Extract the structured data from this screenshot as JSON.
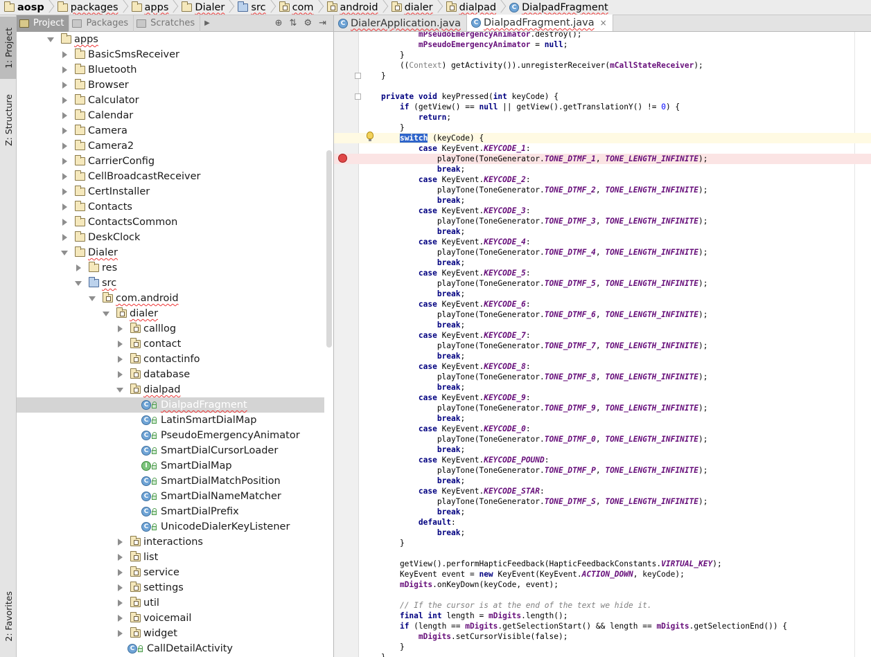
{
  "breadcrumb": [
    "aosp",
    "packages",
    "apps",
    "Dialer",
    "src",
    "com",
    "android",
    "dialer",
    "dialpad",
    "DialpadFragment"
  ],
  "tool_strip": {
    "project": "1: Project",
    "structure": "Z: Structure",
    "favorites": "2: Favorites"
  },
  "panel_tabs": [
    "Project",
    "Packages",
    "Scratches"
  ],
  "tree": [
    {
      "label": "apps",
      "depth": 0,
      "state": "open",
      "icon": "folder-icon",
      "wavy": true
    },
    {
      "label": "BasicSmsReceiver",
      "depth": 1,
      "state": "closed",
      "icon": "folder-icon"
    },
    {
      "label": "Bluetooth",
      "depth": 1,
      "state": "closed",
      "icon": "folder-icon"
    },
    {
      "label": "Browser",
      "depth": 1,
      "state": "closed",
      "icon": "folder-icon"
    },
    {
      "label": "Calculator",
      "depth": 1,
      "state": "closed",
      "icon": "folder-icon"
    },
    {
      "label": "Calendar",
      "depth": 1,
      "state": "closed",
      "icon": "folder-icon"
    },
    {
      "label": "Camera",
      "depth": 1,
      "state": "closed",
      "icon": "folder-icon"
    },
    {
      "label": "Camera2",
      "depth": 1,
      "state": "closed",
      "icon": "folder-icon"
    },
    {
      "label": "CarrierConfig",
      "depth": 1,
      "state": "closed",
      "icon": "folder-icon"
    },
    {
      "label": "CellBroadcastReceiver",
      "depth": 1,
      "state": "closed",
      "icon": "folder-icon"
    },
    {
      "label": "CertInstaller",
      "depth": 1,
      "state": "closed",
      "icon": "folder-icon"
    },
    {
      "label": "Contacts",
      "depth": 1,
      "state": "closed",
      "icon": "folder-icon"
    },
    {
      "label": "ContactsCommon",
      "depth": 1,
      "state": "closed",
      "icon": "folder-icon"
    },
    {
      "label": "DeskClock",
      "depth": 1,
      "state": "closed",
      "icon": "folder-icon"
    },
    {
      "label": "Dialer",
      "depth": 1,
      "state": "open",
      "icon": "folder-icon",
      "wavy": true
    },
    {
      "label": "res",
      "depth": 2,
      "state": "closed",
      "icon": "folder-icon"
    },
    {
      "label": "src",
      "depth": 2,
      "state": "open",
      "icon": "source-folder-icon",
      "wavy": true
    },
    {
      "label": "com.android",
      "depth": 3,
      "state": "open",
      "icon": "package-icon",
      "wavy": true
    },
    {
      "label": "dialer",
      "depth": 4,
      "state": "open",
      "icon": "package-icon",
      "wavy": true
    },
    {
      "label": "calllog",
      "depth": 5,
      "state": "closed",
      "icon": "package-icon"
    },
    {
      "label": "contact",
      "depth": 5,
      "state": "closed",
      "icon": "package-icon"
    },
    {
      "label": "contactinfo",
      "depth": 5,
      "state": "closed",
      "icon": "package-icon"
    },
    {
      "label": "database",
      "depth": 5,
      "state": "closed",
      "icon": "package-icon"
    },
    {
      "label": "dialpad",
      "depth": 5,
      "state": "open",
      "icon": "package-icon",
      "wavy": true
    },
    {
      "label": "DialpadFragment",
      "depth": 6,
      "state": "leaf",
      "icon": "class-icon",
      "selected": true,
      "wavy": true
    },
    {
      "label": "LatinSmartDialMap",
      "depth": 6,
      "state": "leaf",
      "icon": "class-icon"
    },
    {
      "label": "PseudoEmergencyAnimator",
      "depth": 6,
      "state": "leaf",
      "icon": "class-icon"
    },
    {
      "label": "SmartDialCursorLoader",
      "depth": 6,
      "state": "leaf",
      "icon": "class-icon"
    },
    {
      "label": "SmartDialMap",
      "depth": 6,
      "state": "leaf",
      "icon": "interface-icon"
    },
    {
      "label": "SmartDialMatchPosition",
      "depth": 6,
      "state": "leaf",
      "icon": "class-icon"
    },
    {
      "label": "SmartDialNameMatcher",
      "depth": 6,
      "state": "leaf",
      "icon": "class-icon"
    },
    {
      "label": "SmartDialPrefix",
      "depth": 6,
      "state": "leaf",
      "icon": "class-icon"
    },
    {
      "label": "UnicodeDialerKeyListener",
      "depth": 6,
      "state": "leaf",
      "icon": "class-icon"
    },
    {
      "label": "interactions",
      "depth": 5,
      "state": "closed",
      "icon": "package-icon"
    },
    {
      "label": "list",
      "depth": 5,
      "state": "closed",
      "icon": "package-icon"
    },
    {
      "label": "service",
      "depth": 5,
      "state": "closed",
      "icon": "package-icon"
    },
    {
      "label": "settings",
      "depth": 5,
      "state": "closed",
      "icon": "package-icon"
    },
    {
      "label": "util",
      "depth": 5,
      "state": "closed",
      "icon": "package-icon"
    },
    {
      "label": "voicemail",
      "depth": 5,
      "state": "closed",
      "icon": "package-icon"
    },
    {
      "label": "widget",
      "depth": 5,
      "state": "closed",
      "icon": "package-icon"
    },
    {
      "label": "CallDetailActivity",
      "depth": 5,
      "state": "leaf",
      "icon": "class-icon"
    }
  ],
  "editor_tabs": [
    {
      "label": "DialerApplication.java",
      "active": false
    },
    {
      "label": "DialpadFragment.java",
      "active": true,
      "close": "×"
    }
  ],
  "code_lines": [
    {
      "t": "        mPseudoEmergencyAnimator.destroy();"
    },
    {
      "t": "        mPseudoEmergencyAnimator = null;"
    },
    {
      "t": "    }"
    },
    {
      "t": "    ((Context) getActivity()).unregisterReceiver(mCallStateReceiver);"
    },
    {
      "t": "}"
    },
    {
      "t": ""
    },
    {
      "t": "private void keyPressed(int keyCode) {"
    },
    {
      "t": "    if (getView() == null || getView().getTranslationY() != 0) {"
    },
    {
      "t": "        return;"
    },
    {
      "t": "    }"
    },
    {
      "t": "    switch (keyCode) {",
      "caret": true
    },
    {
      "t": "        case KeyEvent.KEYCODE_1:"
    },
    {
      "t": "            playTone(ToneGenerator.TONE_DTMF_1, TONE_LENGTH_INFINITE);",
      "breakpoint": true
    },
    {
      "t": "            break;"
    },
    {
      "t": "        case KeyEvent.KEYCODE_2:"
    },
    {
      "t": "            playTone(ToneGenerator.TONE_DTMF_2, TONE_LENGTH_INFINITE);"
    },
    {
      "t": "            break;"
    },
    {
      "t": "        case KeyEvent.KEYCODE_3:"
    },
    {
      "t": "            playTone(ToneGenerator.TONE_DTMF_3, TONE_LENGTH_INFINITE);"
    },
    {
      "t": "            break;"
    },
    {
      "t": "        case KeyEvent.KEYCODE_4:"
    },
    {
      "t": "            playTone(ToneGenerator.TONE_DTMF_4, TONE_LENGTH_INFINITE);"
    },
    {
      "t": "            break;"
    },
    {
      "t": "        case KeyEvent.KEYCODE_5:"
    },
    {
      "t": "            playTone(ToneGenerator.TONE_DTMF_5, TONE_LENGTH_INFINITE);"
    },
    {
      "t": "            break;"
    },
    {
      "t": "        case KeyEvent.KEYCODE_6:"
    },
    {
      "t": "            playTone(ToneGenerator.TONE_DTMF_6, TONE_LENGTH_INFINITE);"
    },
    {
      "t": "            break;"
    },
    {
      "t": "        case KeyEvent.KEYCODE_7:"
    },
    {
      "t": "            playTone(ToneGenerator.TONE_DTMF_7, TONE_LENGTH_INFINITE);"
    },
    {
      "t": "            break;"
    },
    {
      "t": "        case KeyEvent.KEYCODE_8:"
    },
    {
      "t": "            playTone(ToneGenerator.TONE_DTMF_8, TONE_LENGTH_INFINITE);"
    },
    {
      "t": "            break;"
    },
    {
      "t": "        case KeyEvent.KEYCODE_9:"
    },
    {
      "t": "            playTone(ToneGenerator.TONE_DTMF_9, TONE_LENGTH_INFINITE);"
    },
    {
      "t": "            break;"
    },
    {
      "t": "        case KeyEvent.KEYCODE_0:"
    },
    {
      "t": "            playTone(ToneGenerator.TONE_DTMF_0, TONE_LENGTH_INFINITE);"
    },
    {
      "t": "            break;"
    },
    {
      "t": "        case KeyEvent.KEYCODE_POUND:"
    },
    {
      "t": "            playTone(ToneGenerator.TONE_DTMF_P, TONE_LENGTH_INFINITE);"
    },
    {
      "t": "            break;"
    },
    {
      "t": "        case KeyEvent.KEYCODE_STAR:"
    },
    {
      "t": "            playTone(ToneGenerator.TONE_DTMF_S, TONE_LENGTH_INFINITE);"
    },
    {
      "t": "            break;"
    },
    {
      "t": "        default:"
    },
    {
      "t": "            break;"
    },
    {
      "t": "    }"
    },
    {
      "t": ""
    },
    {
      "t": "    getView().performHapticFeedback(HapticFeedbackConstants.VIRTUAL_KEY);"
    },
    {
      "t": "    KeyEvent event = new KeyEvent(KeyEvent.ACTION_DOWN, keyCode);"
    },
    {
      "t": "    mDigits.onKeyDown(keyCode, event);"
    },
    {
      "t": ""
    },
    {
      "t": "    // If the cursor is at the end of the text we hide it."
    },
    {
      "t": "    final int length = mDigits.length();"
    },
    {
      "t": "    if (length == mDigits.getSelectionStart() && length == mDigits.getSelectionEnd()) {"
    },
    {
      "t": "        mDigits.setCursorVisible(false);"
    },
    {
      "t": "    }"
    },
    {
      "t": "}"
    }
  ],
  "colors": {
    "keyword": "#000080",
    "field": "#660e7a",
    "number": "#0000ff",
    "comment": "#808080",
    "selection": "#2f65ca",
    "caret_line": "#fffae3",
    "breakpoint_line": "#fbe4e4"
  }
}
